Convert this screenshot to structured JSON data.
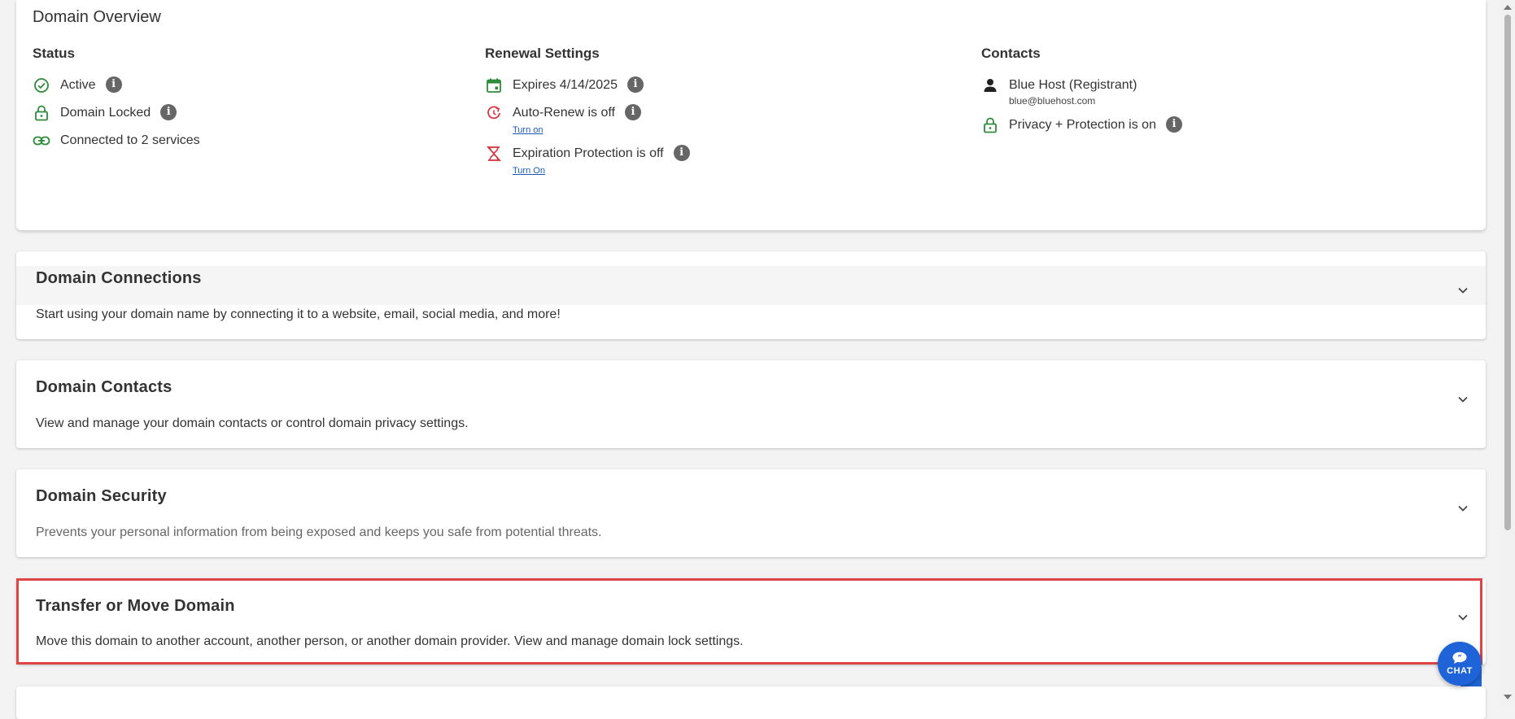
{
  "overview": {
    "title": "Domain Overview",
    "status": {
      "title": "Status",
      "active": "Active",
      "locked": "Domain Locked",
      "connected": "Connected to 2 services"
    },
    "renewal": {
      "title": "Renewal Settings",
      "expires": "Expires 4/14/2025",
      "auto_renew": "Auto-Renew is off",
      "auto_renew_link": "Turn on",
      "expiration_protection": "Expiration Protection is off",
      "expiration_protection_link": "Turn On"
    },
    "contacts": {
      "title": "Contacts",
      "registrant": "Blue Host (Registrant)",
      "email": "blue@bluehost.com",
      "privacy": "Privacy + Protection is on"
    }
  },
  "sections": [
    {
      "title": "Domain Connections",
      "desc": "Start using your domain name by connecting it to a website, email, social media, and more!"
    },
    {
      "title": "Domain Contacts",
      "desc": "View and manage your domain contacts or control domain privacy settings."
    },
    {
      "title": "Domain Security",
      "desc": "Prevents your personal information from being exposed and keeps you safe from potential threats."
    },
    {
      "title": "Transfer or Move Domain",
      "desc": "Move this domain to another account, another person, or another domain provider. View and manage domain lock settings."
    }
  ],
  "chat": {
    "label": "CHAT"
  },
  "colors": {
    "green": "#2e8b3a",
    "red": "#d9343f",
    "link": "#1a5bb8",
    "info": "#666666",
    "highlight": "#e04545",
    "chat": "#1e64d8"
  },
  "icons": {
    "active": "check-circle-icon",
    "locked": "lock-icon",
    "connected": "link-icon",
    "expires": "calendar-icon",
    "auto_renew": "renew-off-icon",
    "expiration_protection": "hourglass-off-icon",
    "registrant": "person-icon",
    "privacy": "lock-icon",
    "info": "info-icon",
    "chevron": "chevron-down-icon",
    "chat": "chat-bubble-icon"
  }
}
